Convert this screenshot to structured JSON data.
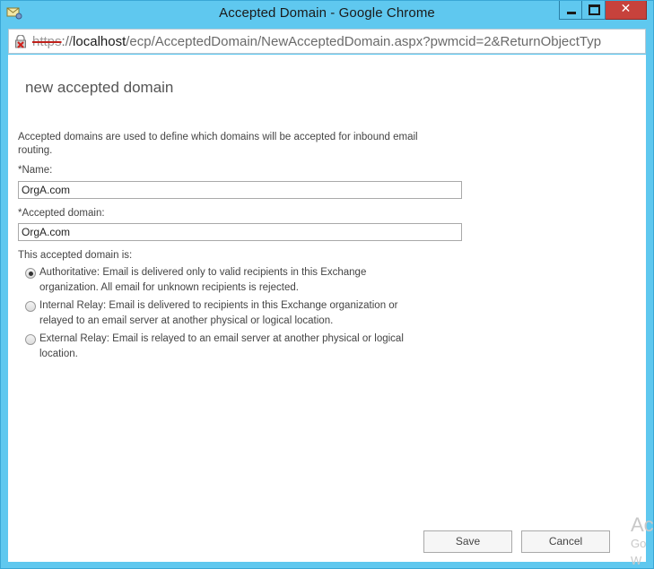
{
  "window": {
    "title": "Accepted Domain - Google Chrome",
    "close_glyph": "✕"
  },
  "address": {
    "scheme": "https",
    "separator": "://",
    "host": "localhost",
    "path": "/ecp/AcceptedDomain/NewAcceptedDomain.aspx?pwmcid=2&ReturnObjectTyp"
  },
  "form": {
    "title": "new accepted domain",
    "description": "Accepted domains are used to define which domains will be accepted for inbound email routing.",
    "name_label": "*Name:",
    "name_value": "OrgA.com",
    "domain_label": "*Accepted domain:",
    "domain_value": "OrgA.com",
    "type_label": "This accepted domain is:",
    "options": [
      {
        "label": "Authoritative: Email is delivered only to valid recipients in this Exchange organization. All email for unknown recipients is rejected.",
        "checked": true
      },
      {
        "label": "Internal Relay: Email is delivered to recipients in this Exchange organization or relayed to an email server at another physical or logical location.",
        "checked": false
      },
      {
        "label": "External Relay: Email is relayed to an email server at another physical or logical location.",
        "checked": false
      }
    ]
  },
  "buttons": {
    "save": "Save",
    "cancel": "Cancel"
  },
  "watermark": {
    "line1": "Ac",
    "line2": "Go",
    "line3": "W"
  }
}
